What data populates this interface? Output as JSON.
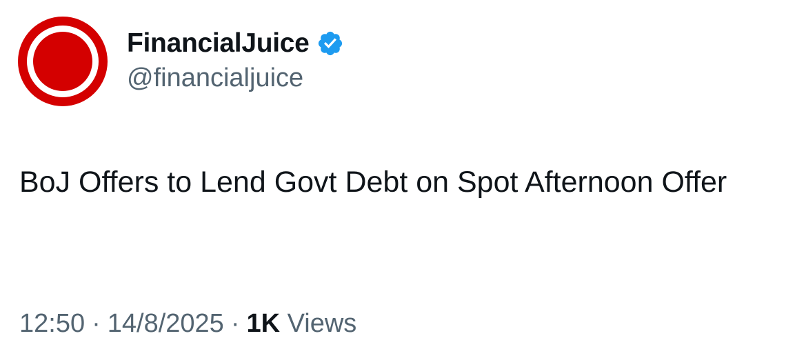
{
  "author": {
    "display_name": "FinancialJuice",
    "handle": "@financialjuice",
    "verified": true,
    "avatar_icon": "red-ring-logo-icon",
    "verified_icon": "verified-badge-icon",
    "avatar_color": "#d40000",
    "verified_color": "#1d9bf0"
  },
  "tweet": {
    "text": "BoJ Offers to Lend Govt Debt on Spot Afternoon Offer",
    "time": "12:50",
    "date": "14/8/2025",
    "separator": "·",
    "views_count": "1K",
    "views_label": "Views"
  }
}
